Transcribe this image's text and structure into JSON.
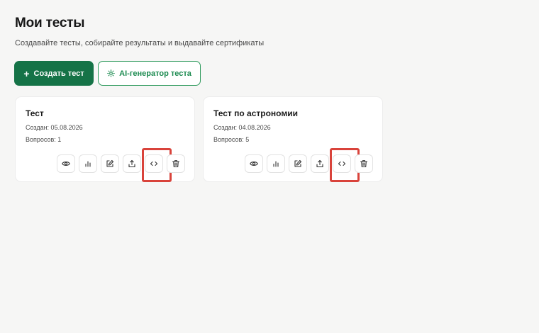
{
  "header": {
    "title": "Мои тесты",
    "subtitle": "Создавайте тесты, собирайте результаты и выдавайте сертификаты"
  },
  "toolbar": {
    "create_label": "Создать тест",
    "create_icon": "plus-icon",
    "ai_label": "AI-генератор теста",
    "ai_icon": "sun-sparkle-icon"
  },
  "colors": {
    "primary": "#157347",
    "accent_text": "#1b8a4f",
    "highlight": "#d9433b"
  },
  "tests": [
    {
      "title": "Тест",
      "created": "Создан: 05.08.2026",
      "questions": "Вопросов: 1"
    },
    {
      "title": "Тест по астрономии",
      "created": "Создан: 04.08.2026",
      "questions": "Вопросов: 5"
    }
  ],
  "card_actions": [
    "eye-icon",
    "bar-chart-icon",
    "edit-icon",
    "share-icon",
    "code-icon",
    "trash-icon"
  ]
}
